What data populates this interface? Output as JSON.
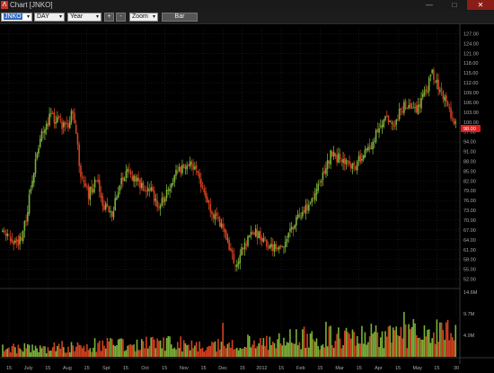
{
  "window": {
    "title": "Chart [JNKO]",
    "minimize_glyph": "—",
    "maximize_glyph": "□",
    "close_glyph": "✕"
  },
  "toolbar": {
    "symbol_value": "JNKO",
    "period_value": "DAY",
    "range_value": "Year",
    "zoom_in_label": "+",
    "zoom_out_label": "-",
    "zoom_value": "Zoom",
    "type_label": "Bar",
    "dropdown_glyph": "▾"
  },
  "colors": {
    "background": "#000000",
    "up": "#7ab03a",
    "down": "#d2411f",
    "grid": "#2a2a2a",
    "price_badge": "#e01e1e"
  },
  "price_badge": "98.00",
  "chart_data": {
    "type": "candlestick",
    "price_axis": {
      "ticks": [
        "127.00",
        "124.00",
        "121.00",
        "118.00",
        "115.00",
        "112.00",
        "109.00",
        "106.00",
        "103.00",
        "100.00",
        "97.00",
        "94.00",
        "91.00",
        "88.00",
        "85.00",
        "82.00",
        "79.00",
        "76.00",
        "73.00",
        "70.00",
        "67.00",
        "64.00",
        "61.00",
        "58.00",
        "55.00",
        "52.00"
      ],
      "range": [
        50.5,
        128.5
      ]
    },
    "volume_axis": {
      "ticks": [
        "14.6M",
        "9.7M",
        "4.9M"
      ],
      "range": [
        0,
        14.6
      ]
    },
    "x_ticks": [
      "15",
      "July",
      "15",
      "Aug",
      "15",
      "Spt",
      "15",
      "Oct",
      "15",
      "Nov",
      "15",
      "Dec",
      "15",
      "2012",
      "15",
      "Feb",
      "15",
      "Mar",
      "15",
      "Apr",
      "15",
      "May",
      "15",
      "30"
    ],
    "price_path": [
      [
        0,
        67
      ],
      [
        5,
        64
      ],
      [
        10,
        62
      ],
      [
        15,
        70
      ],
      [
        20,
        86
      ],
      [
        25,
        97
      ],
      [
        30,
        101
      ],
      [
        35,
        101
      ],
      [
        40,
        98
      ],
      [
        45,
        103
      ],
      [
        50,
        84
      ],
      [
        55,
        78
      ],
      [
        60,
        83
      ],
      [
        65,
        74
      ],
      [
        70,
        72
      ],
      [
        75,
        81
      ],
      [
        80,
        85
      ],
      [
        85,
        82
      ],
      [
        90,
        80
      ],
      [
        95,
        79
      ],
      [
        100,
        74
      ],
      [
        105,
        78
      ],
      [
        110,
        84
      ],
      [
        115,
        86
      ],
      [
        120,
        88
      ],
      [
        125,
        85
      ],
      [
        130,
        76
      ],
      [
        135,
        71
      ],
      [
        140,
        68
      ],
      [
        145,
        62
      ],
      [
        150,
        56
      ],
      [
        155,
        63
      ],
      [
        160,
        67
      ],
      [
        165,
        65
      ],
      [
        170,
        62
      ],
      [
        175,
        61
      ],
      [
        180,
        63
      ],
      [
        185,
        67
      ],
      [
        190,
        72
      ],
      [
        195,
        74
      ],
      [
        200,
        78
      ],
      [
        205,
        84
      ],
      [
        210,
        90
      ],
      [
        215,
        89
      ],
      [
        220,
        88
      ],
      [
        225,
        86
      ],
      [
        230,
        90
      ],
      [
        235,
        92
      ],
      [
        240,
        98
      ],
      [
        245,
        101
      ],
      [
        250,
        99
      ],
      [
        255,
        104
      ],
      [
        260,
        106
      ],
      [
        265,
        103
      ],
      [
        270,
        108
      ],
      [
        275,
        115
      ],
      [
        280,
        110
      ],
      [
        285,
        104
      ],
      [
        290,
        99
      ]
    ],
    "volume_profile": [
      2.2,
      2.6,
      3.1,
      3.4,
      2.9,
      3.6,
      4.5,
      5.1,
      5.6,
      6.4
    ],
    "last_price": 98
  }
}
